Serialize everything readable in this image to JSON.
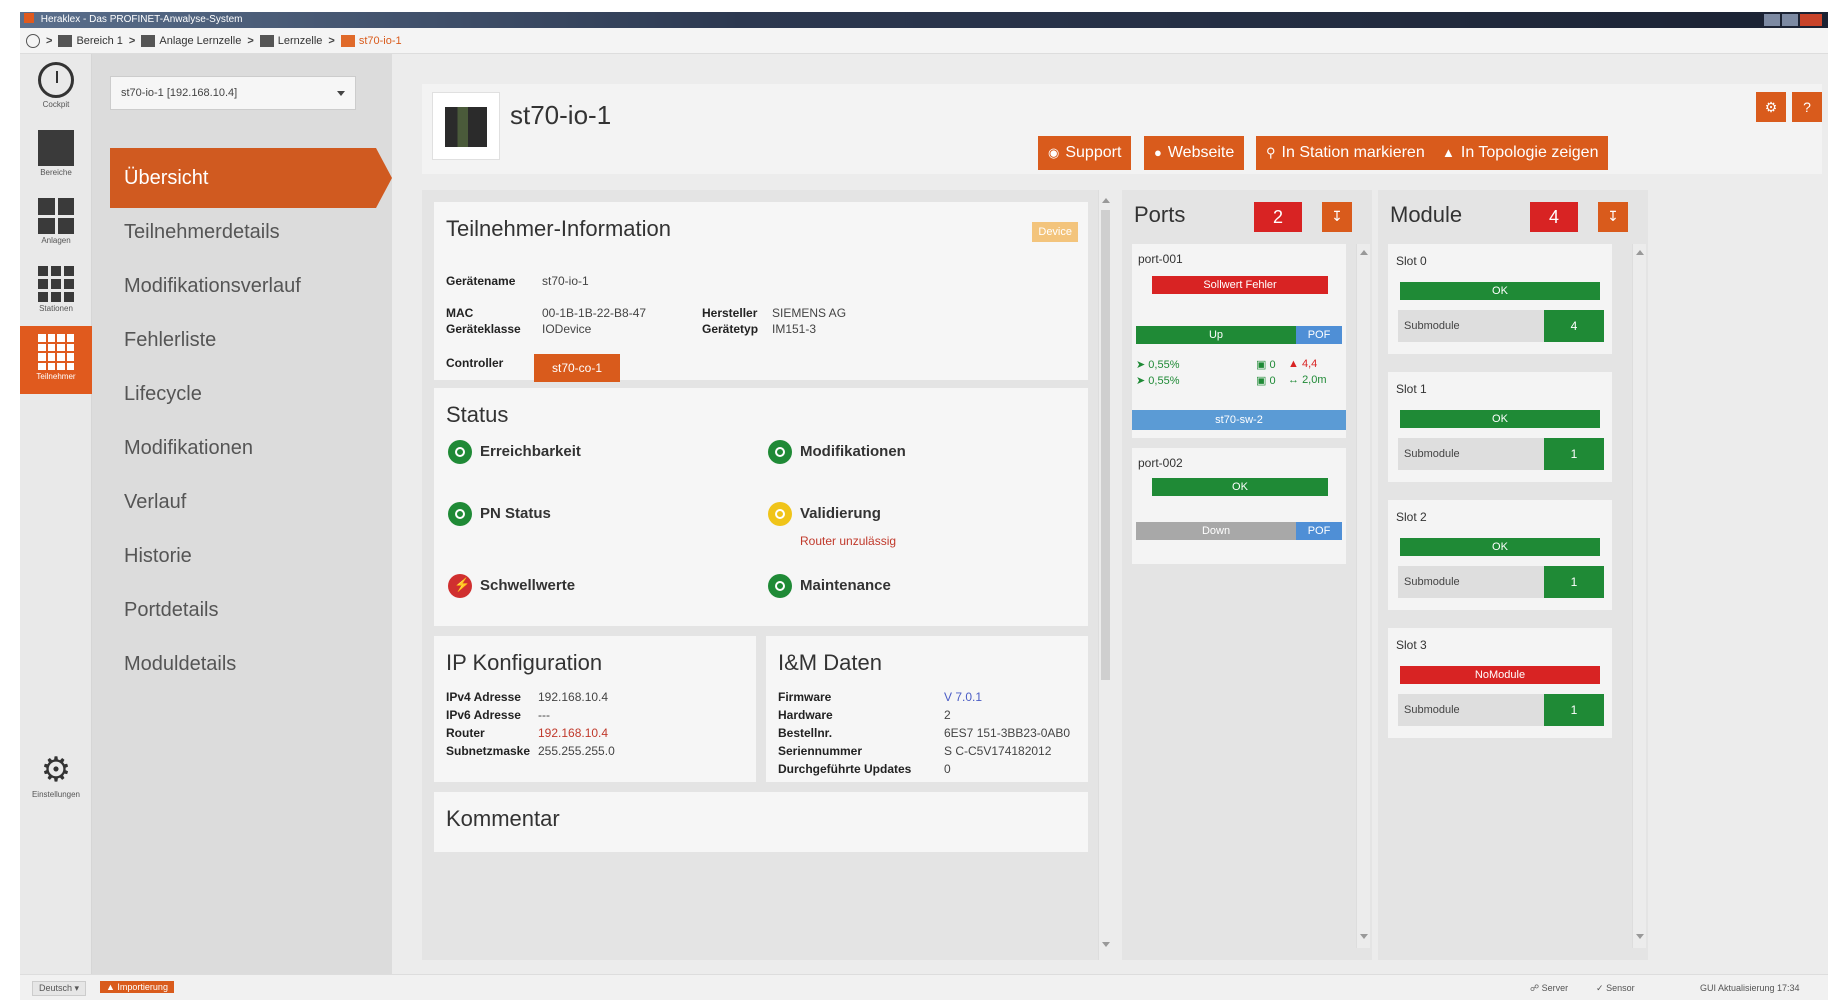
{
  "window": {
    "title": "Heraklex - Das PROFINET-Anwalyse-System"
  },
  "breadcrumb": [
    "Bereich 1",
    "Anlage Lernzelle",
    "Lernzelle",
    "st70-io-1"
  ],
  "rail": [
    {
      "label": "Cockpit",
      "icon": "clock-icon"
    },
    {
      "label": "Bereiche",
      "icon": "square-icon"
    },
    {
      "label": "Anlagen",
      "icon": "grid4-icon"
    },
    {
      "label": "Stationen",
      "icon": "grid9-icon"
    },
    {
      "label": "Teilnehmer",
      "icon": "grid16-icon",
      "active": true
    },
    {
      "label": "Einstellungen",
      "icon": "gear-icon"
    }
  ],
  "device_selector": "st70-io-1 [192.168.10.4]",
  "nav": [
    "Übersicht",
    "Teilnehmerdetails",
    "Modifikationsverlauf",
    "Fehlerliste",
    "Lifecycle",
    "Modifikationen",
    "Verlauf",
    "Historie",
    "Portdetails",
    "Moduldetails"
  ],
  "header": {
    "device_name": "st70-io-1",
    "buttons": {
      "support": "Support",
      "webseite": "Webseite",
      "mark": "In Station markieren",
      "topology": "In Topologie zeigen"
    }
  },
  "teilnehmer": {
    "title": "Teilnehmer-Information",
    "tag": "Device",
    "geraetename_label": "Gerätename",
    "geraetename": "st70-io-1",
    "mac_label": "MAC",
    "mac": "00-1B-1B-22-B8-47",
    "hersteller_label": "Hersteller",
    "hersteller": "SIEMENS AG",
    "klasse_label": "Geräteklasse",
    "klasse": "IODevice",
    "typ_label": "Gerätetyp",
    "typ": "IM151-3",
    "controller_label": "Controller",
    "controller": "st70-co-1"
  },
  "status": {
    "title": "Status",
    "erreichbarkeit": "Erreichbarkeit",
    "modifikationen": "Modifikationen",
    "pn_status": "PN Status",
    "validierung": "Validierung",
    "validierung_sub": "Router unzulässig",
    "schwellwerte": "Schwellwerte",
    "maintenance": "Maintenance"
  },
  "ip": {
    "title": "IP Konfiguration",
    "ipv4_label": "IPv4 Adresse",
    "ipv4": "192.168.10.4",
    "ipv6_label": "IPv6 Adresse",
    "ipv6": "---",
    "router_label": "Router",
    "router": "192.168.10.4",
    "subnet_label": "Subnetzmaske",
    "subnet": "255.255.255.0"
  },
  "im": {
    "title": "I&M Daten",
    "firmware_label": "Firmware",
    "firmware": "V 7.0.1",
    "hardware_label": "Hardware",
    "hardware": "2",
    "bestell_label": "Bestellnr.",
    "bestell": "6ES7 151-3BB23-0AB0",
    "serien_label": "Seriennummer",
    "serien": "S C-C5V174182012",
    "updates_label": "Durchgeführte Updates",
    "updates": "0"
  },
  "kommentar": {
    "title": "Kommentar"
  },
  "ports": {
    "title": "Ports",
    "count": "2",
    "items": [
      {
        "name": "port-001",
        "status": "Sollwert Fehler",
        "link": "Up",
        "medium": "POF",
        "rx": "0,55%",
        "tx": "0,55%",
        "err1": "0",
        "err2": "0",
        "load": "4,4",
        "length": "2,0m",
        "neighbor": "st70-sw-2"
      },
      {
        "name": "port-002",
        "status": "OK",
        "link": "Down",
        "medium": "POF"
      }
    ]
  },
  "module": {
    "title": "Module",
    "count": "4",
    "submodule_label": "Submodule",
    "slots": [
      {
        "name": "Slot 0",
        "status": "OK",
        "sub": "4"
      },
      {
        "name": "Slot 1",
        "status": "OK",
        "sub": "1"
      },
      {
        "name": "Slot 2",
        "status": "OK",
        "sub": "1"
      },
      {
        "name": "Slot 3",
        "status": "NoModule",
        "sub": "1"
      }
    ]
  },
  "statusbar": {
    "language": "Deutsch",
    "warning": "Importierung",
    "server": "Server",
    "sensor": "Sensor",
    "update": "GUI Aktualisierung 17:34"
  },
  "colors": {
    "accent": "#d95b1c",
    "ok": "#1f8a36",
    "error": "#d82323",
    "link": "#5b9bd5"
  }
}
